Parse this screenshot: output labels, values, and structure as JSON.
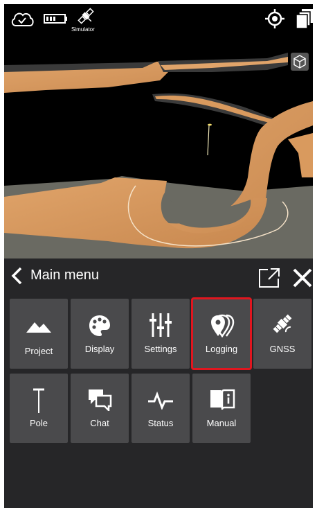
{
  "topbar": {
    "icons": [
      "cloud-check-icon",
      "battery-icon",
      "satellite-icon",
      "gps-target-icon",
      "layers-icon"
    ],
    "simulator_label": "Simulator"
  },
  "viewport": {
    "view_cube_icon": "cube-icon"
  },
  "menu": {
    "back_icon": "chevron-left-icon",
    "title": "Main menu",
    "popout_icon": "external-window-icon",
    "close_icon": "close-icon",
    "tiles": [
      {
        "label": "Project",
        "icon": "mountain-icon"
      },
      {
        "label": "Display",
        "icon": "palette-icon"
      },
      {
        "label": "Settings",
        "icon": "sliders-icon"
      },
      {
        "label": "Logging",
        "icon": "location-pins-icon",
        "selected": true
      },
      {
        "label": "GNSS",
        "icon": "satellite-icon"
      },
      {
        "label": "Pole",
        "icon": "pole-icon"
      },
      {
        "label": "Chat",
        "icon": "chat-icon"
      },
      {
        "label": "Status",
        "icon": "pulse-icon"
      },
      {
        "label": "Manual",
        "icon": "manual-book-icon"
      }
    ]
  },
  "colors": {
    "selection_outline": "#e0161f",
    "tile_background": "#4a4a4c",
    "panel_background": "#262628",
    "road_surface": "#d99a5e"
  }
}
